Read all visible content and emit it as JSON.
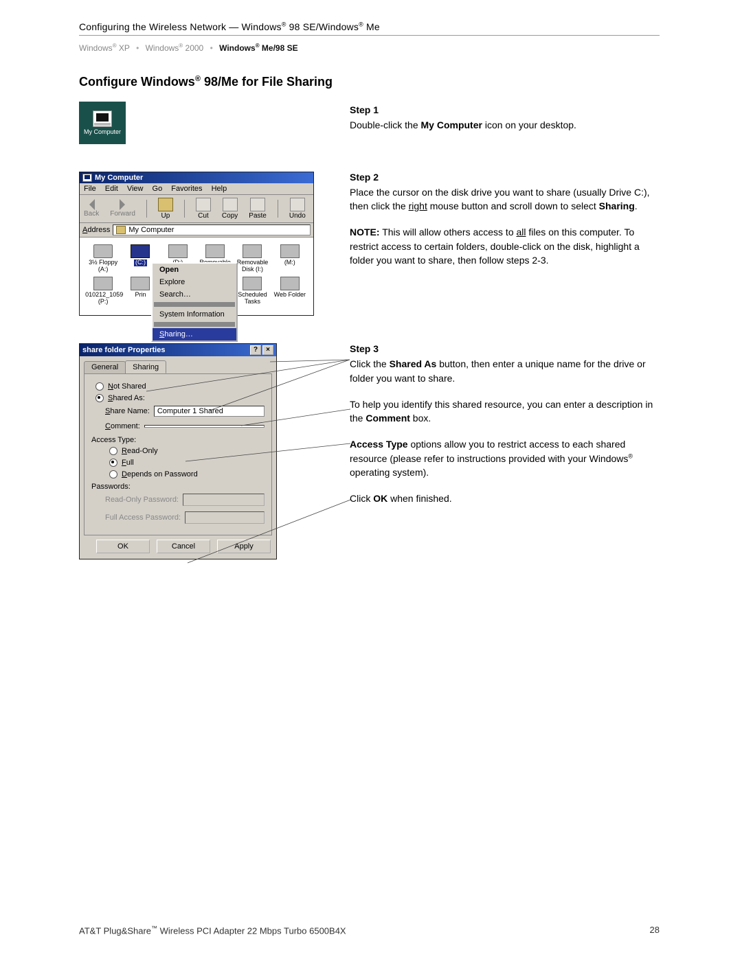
{
  "header": {
    "title_pre": "Configuring the Wireless Network — Windows",
    "title_mid": " 98 SE/Windows",
    "title_end": " Me"
  },
  "breadcrumb": {
    "xp": "Windows",
    "xp_suf": " XP",
    "w2000": "Windows",
    "w2000_suf": " 2000",
    "current": "Windows",
    "current_suf": " Me/98 SE"
  },
  "section_title_pre": "Configure Windows",
  "section_title_post": " 98/Me for File Sharing",
  "mycomputer_label": "My Computer",
  "explorer": {
    "title": "My Computer",
    "menus": {
      "file": "File",
      "edit": "Edit",
      "view": "View",
      "go": "Go",
      "favorites": "Favorites",
      "help": "Help"
    },
    "toolbar": {
      "back": "Back",
      "forward": "Forward",
      "up": "Up",
      "cut": "Cut",
      "copy": "Copy",
      "paste": "Paste",
      "undo": "Undo"
    },
    "address_label": "Address",
    "address_value": "My Computer",
    "drives": {
      "floppy": "3½ Floppy (A:)",
      "c": "(C:)",
      "d": "(D:)",
      "removable": "Removable",
      "removable2a": "Removable",
      "removable2b": "Disk (I:)",
      "m": "(M:)",
      "p_name": "010212_1059",
      "p_sub": "(P:)",
      "printers": "Prin",
      "scheduled": "Scheduled",
      "scheduled2": "Tasks",
      "webfolder": "Web Folder"
    },
    "context": {
      "open": "Open",
      "explore": "Explore",
      "search": "Search…",
      "sysinfo": "System Information",
      "sharing": "Sharing…"
    }
  },
  "dialog": {
    "title": "share folder Properties",
    "help_btn": "?",
    "close_btn": "×",
    "tab_general": "General",
    "tab_sharing": "Sharing",
    "not_shared": "Not Shared",
    "shared_as": "Shared As:",
    "share_name_label": "Share Name:",
    "share_name_value": "Computer 1 Shared",
    "comment_label": "Comment:",
    "access_type": "Access Type:",
    "read_only": "Read-Only",
    "full": "Full",
    "depends": "Depends on Password",
    "passwords": "Passwords:",
    "ro_pass": "Read-Only Password:",
    "full_pass": "Full Access Password:",
    "ok": "OK",
    "cancel": "Cancel",
    "apply": "Apply"
  },
  "steps": {
    "s1_h": "Step 1",
    "s1_a": "Double-click the ",
    "s1_b": "My Computer",
    "s1_c": " icon on your desktop.",
    "s2_h": "Step 2",
    "s2_a": "Place the cursor on the disk drive you want to share (usually Drive C:), then click the ",
    "s2_b": "right",
    "s2_c": " mouse button and scroll down to select ",
    "s2_d": "Sharing",
    "s2_e": ".",
    "s2_note_a": "NOTE:",
    "s2_note_b": " This will allow others access to ",
    "s2_note_c": "all",
    "s2_note_d": " files on this computer. To restrict access to certain folders, double-click on the disk, highlight a folder you want to share, then follow steps 2-3.",
    "s3_h": "Step 3",
    "s3_a": "Click the ",
    "s3_b": "Shared As",
    "s3_c": " button, then enter a unique name for the drive or folder you want to share.",
    "s3_p2a": "To help you identify this shared resource, you can enter a description in the ",
    "s3_p2b": "Comment",
    "s3_p2c": " box.",
    "s3_p3a": "Access Type",
    "s3_p3b": " options allow you to restrict access to each shared resource (please refer to instructions provided with your Windows",
    "s3_p3c": " operating system).",
    "s3_p4a": "Click ",
    "s3_p4b": "OK",
    "s3_p4c": " when finished."
  },
  "footer": {
    "left_a": "AT&T Plug&Share",
    "left_b": " Wireless PCI Adapter 22 Mbps Turbo 6500B4X",
    "page": "28"
  }
}
